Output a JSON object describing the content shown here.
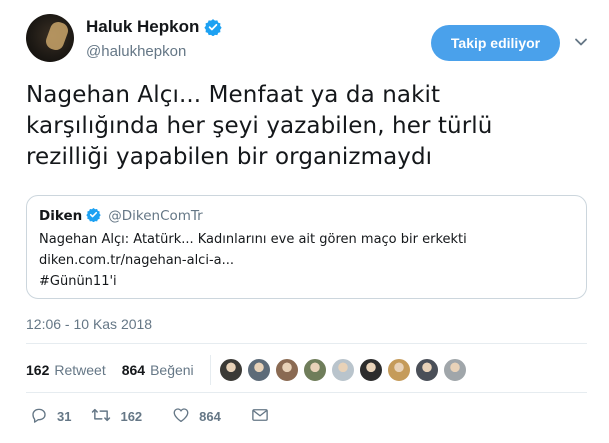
{
  "user": {
    "display_name": "Haluk Hepkon",
    "handle": "@halukhepkon"
  },
  "follow_button_label": "Takip ediliyor",
  "tweet_lines": [
    "Nagehan Alçı... Menfaat ya da nakit",
    "karşılığında her şeyi yazabilen, her türlü",
    "rezilliği yapabilen bir organizmaydı"
  ],
  "quote": {
    "name": "Diken",
    "handle": "@DikenComTr",
    "lines": [
      "Nagehan Alçı: Atatürk... Kadınlarını eve ait gören maço bir erkekti",
      "diken.com.tr/nagehan-alci-a...",
      "#Günün11'i"
    ]
  },
  "timestamp": "12:06 - 10 Kas 2018",
  "stats": {
    "retweet_count": "162",
    "retweet_label": "Retweet",
    "like_count": "864",
    "like_label": "Beğeni"
  },
  "liker_avatar_colors": [
    "#3b3a36",
    "#5d6b78",
    "#8a6a52",
    "#6f7d5a",
    "#b9c4cc",
    "#2c2c2c",
    "#c59b5a",
    "#4a4f58",
    "#a0a6aa"
  ],
  "actions": {
    "reply_count": "31",
    "retweet_count": "162",
    "like_count": "864"
  },
  "icons": {
    "verified": "verified-badge-icon",
    "chevron": "chevron-down-icon",
    "reply": "reply-icon",
    "retweet": "retweet-icon",
    "like": "heart-icon",
    "dm": "envelope-icon"
  },
  "colors": {
    "accent": "#1da1f2",
    "follow_bg": "#4aa1eb",
    "muted": "#657786"
  }
}
